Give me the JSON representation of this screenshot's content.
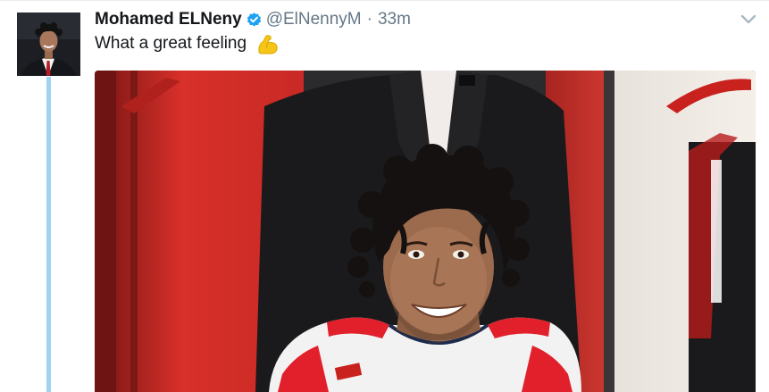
{
  "tweet": {
    "author_name": "Mohamed ELNeny",
    "handle": "@ElNennyM",
    "separator": "·",
    "time": "33m",
    "text": "What a great feeling",
    "emoji": "flexed-biceps",
    "verified": true
  },
  "colors": {
    "thread_line": "#9fd3f2",
    "verified_badge": "#1da1f2",
    "name_text": "#14171a",
    "meta_text": "#657786",
    "locker_red": "#d8302a",
    "jersey_red": "#e1202c"
  },
  "icons": {
    "verified": "verified-badge-icon",
    "menu": "chevron-down-icon",
    "emoji": "flexed-biceps-icon"
  }
}
